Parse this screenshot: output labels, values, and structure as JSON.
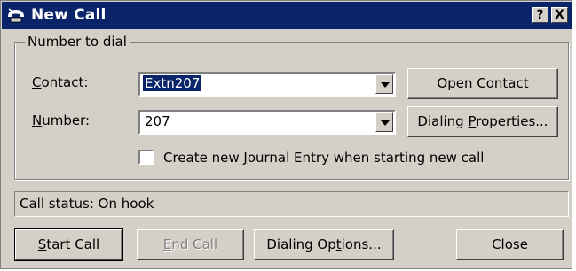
{
  "window": {
    "title": "New Call",
    "help_label": "?",
    "close_glyph": "X"
  },
  "group": {
    "legend": "Number to dial",
    "contact_label": "Contact:",
    "contact_value": "Extn207",
    "number_label": "Number:",
    "number_value": "207",
    "checkbox_label": "Create new Journal Entry when starting new call",
    "checkbox_checked": false
  },
  "buttons": {
    "open_contact": "Open Contact",
    "dialing_properties": "Dialing Properties...",
    "start_call": "Start Call",
    "end_call": "End Call",
    "dialing_options": "Dialing Options...",
    "close": "Close"
  },
  "status": {
    "text": "Call status: On hook"
  },
  "colors": {
    "titlebar": "#0a246a",
    "face": "#d4d0c8",
    "selection": "#0a246a"
  },
  "icons": {
    "title": "phone-icon"
  }
}
